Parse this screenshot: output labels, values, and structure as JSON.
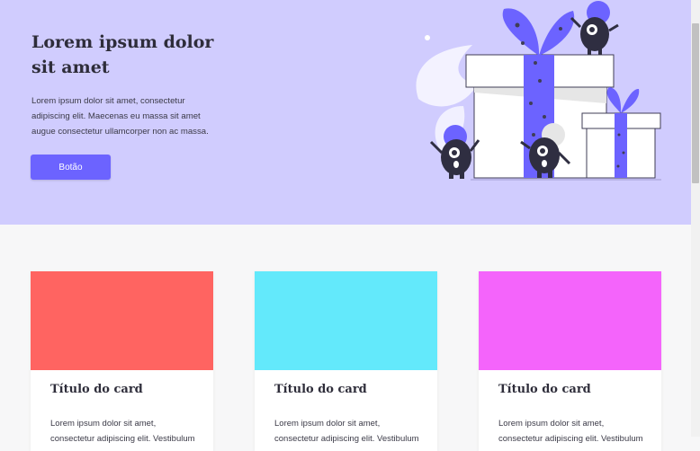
{
  "hero": {
    "title": "Lorem ipsum dolor sit amet",
    "text": "Lorem ipsum dolor sit amet, consectetur adipiscing elit. Maecenas eu massa sit amet augue consectetur ullamcorper non ac massa.",
    "button_label": "Botão",
    "background": "#d0ccfe",
    "accent": "#6c63ff"
  },
  "cards": [
    {
      "title": "Título do card",
      "text": "Lorem ipsum dolor sit amet, consectetur adipiscing elit. Vestibulum",
      "color": "#ff6461"
    },
    {
      "title": "Título do card",
      "text": "Lorem ipsum dolor sit amet, consectetur adipiscing elit. Vestibulum",
      "color": "#63e9fb"
    },
    {
      "title": "Título do card",
      "text": "Lorem ipsum dolor sit amet, consectetur adipiscing elit. Vestibulum",
      "color": "#f464fb"
    }
  ]
}
